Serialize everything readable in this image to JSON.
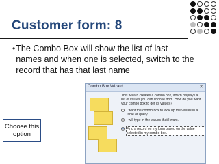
{
  "slide": {
    "title": "Customer form: 8",
    "bullet_char": "•",
    "bullet_text": "The Combo Box will show the list of last names and when one is selected, switch to the record that has that last name",
    "callout": "Choose this option"
  },
  "wizard": {
    "title": "Combo Box Wizard",
    "close_glyph": "✕",
    "intro": "This wizard creates a combo box, which displays a list of values you can choose from. How do you want your combo box to get its values?",
    "options": [
      {
        "label": "I want the combo box to look up the values in a table or query.",
        "selected": false
      },
      {
        "label": "I will type in the values that I want.",
        "selected": false
      },
      {
        "label": "Find a record on my form based on the value I selected in my combo box.",
        "selected": true
      }
    ]
  }
}
